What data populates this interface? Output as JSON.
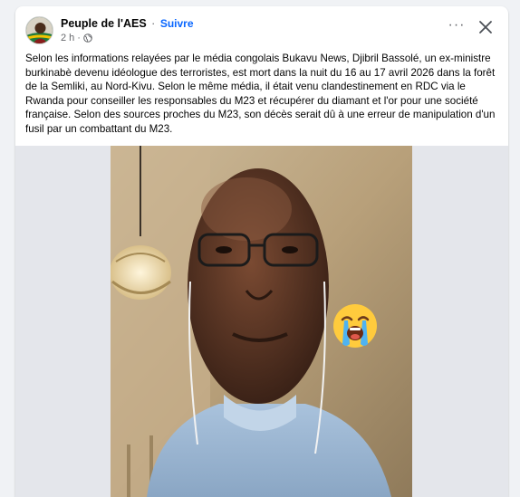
{
  "post": {
    "page_name": "Peuple de l'AES",
    "separator": "·",
    "follow_label": "Suivre",
    "time": "2 h",
    "meta_separator": "·",
    "privacy_icon": "globe-icon",
    "more_label": "···",
    "close_icon": "close-icon",
    "text": "Selon les informations relayées par le média congolais Bukavu News, Djibril Bassolé, un ex-ministre burkinabè devenu idéologue des terroristes, est mort dans la nuit du 16 au 17 avril 2026 dans la forêt de la Semliki, au Nord-Kivu. Selon le même média, il était venu clandestinement en RDC via le Rwanda pour conseiller les responsables du M23 et récupérer du diamant et l'or pour une société française. Selon des sources proches du M23, son décès serait dû à une erreur de manipulation d'un fusil par un combattant du M23."
  },
  "media": {
    "image": "photo of a man in a light blue shirt wearing glasses and earphones",
    "overlay_emoji": "loudly-crying-face-emoji"
  },
  "colors": {
    "background": "#f0f2f5",
    "link": "#0866ff",
    "muted": "#65676b"
  }
}
